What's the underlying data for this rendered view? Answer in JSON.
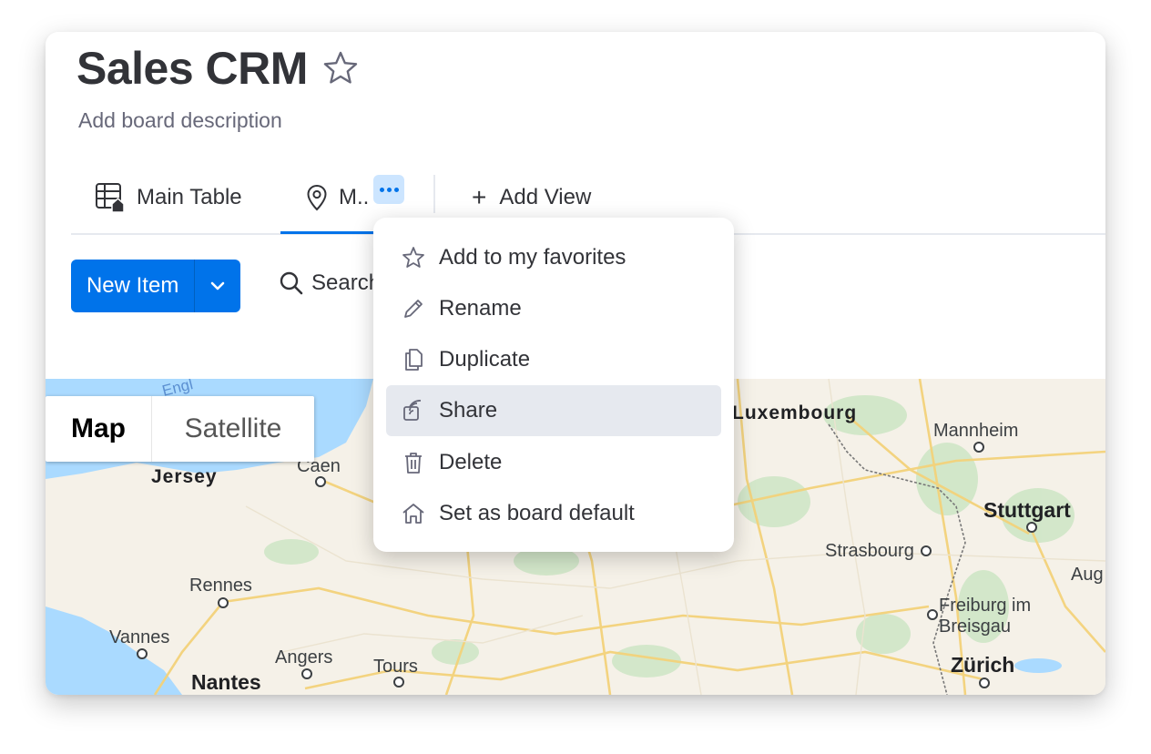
{
  "board": {
    "title": "Sales CRM",
    "description": "Add board description"
  },
  "tabs": {
    "main_table": "Main Table",
    "map": "M..",
    "add_view": "Add View"
  },
  "toolbar": {
    "new_item": "New Item",
    "search": "Search"
  },
  "map_control": {
    "map": "Map",
    "satellite": "Satellite"
  },
  "map_labels": {
    "eng": "Engl",
    "jersey": "Jersey",
    "caen": "Caen",
    "rennes": "Rennes",
    "vannes": "Vannes",
    "angers": "Angers",
    "tours": "Tours",
    "nantes": "Nantes",
    "luxembourg": "Luxembourg",
    "mannheim": "Mannheim",
    "stuttgart": "Stuttgart",
    "strasbourg": "Strasbourg",
    "aug": "Aug",
    "freiburg1": "Freiburg im",
    "freiburg2": "Breisgau",
    "zurich": "Zürich"
  },
  "context_menu": {
    "items": [
      {
        "label": "Add to my favorites",
        "icon": "star-icon"
      },
      {
        "label": "Rename",
        "icon": "pencil-icon"
      },
      {
        "label": "Duplicate",
        "icon": "duplicate-icon"
      },
      {
        "label": "Share",
        "icon": "share-icon",
        "highlighted": true
      },
      {
        "label": "Delete",
        "icon": "trash-icon"
      },
      {
        "label": "Set as board default",
        "icon": "home-icon"
      }
    ]
  },
  "colors": {
    "primary": "#0073ea",
    "menu_highlight": "#e6e9ef",
    "text": "#323338",
    "muted": "#676879",
    "water": "#aadaff"
  }
}
